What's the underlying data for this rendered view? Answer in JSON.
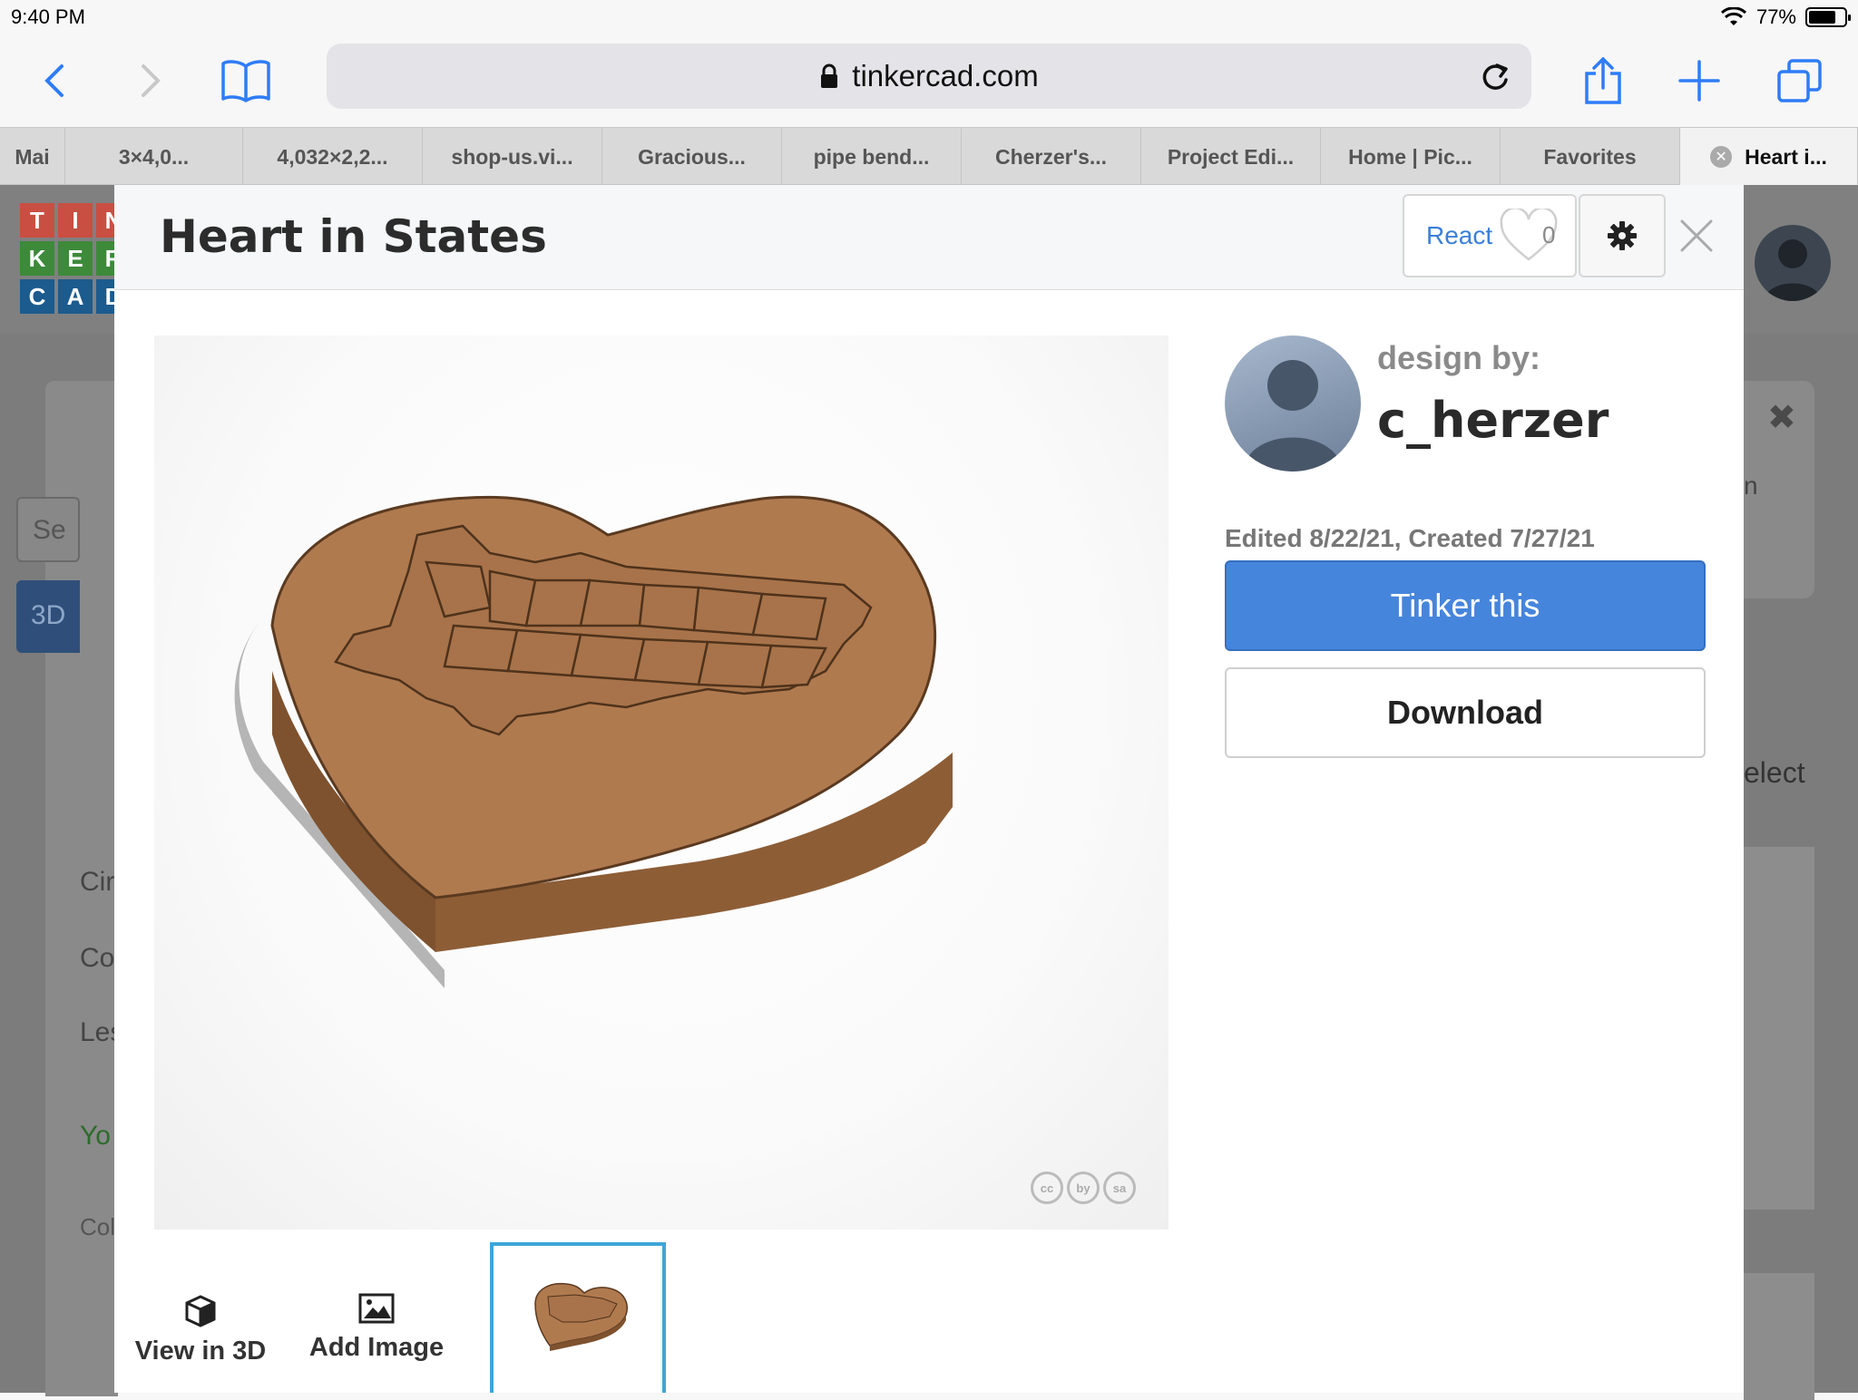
{
  "status_bar": {
    "time": "9:40 PM",
    "battery": "77%",
    "battery_level": 0.77
  },
  "browser": {
    "url": "tinkercad.com",
    "tabs": [
      {
        "label": "Mai",
        "active": false
      },
      {
        "label": "3×4,0...",
        "active": false
      },
      {
        "label": "4,032×2,2...",
        "active": false
      },
      {
        "label": "shop-us.vi...",
        "active": false
      },
      {
        "label": "Gracious...",
        "active": false
      },
      {
        "label": "pipe bend...",
        "active": false
      },
      {
        "label": "Cherzer's...",
        "active": false
      },
      {
        "label": "Project Edi...",
        "active": false
      },
      {
        "label": "Home | Pic...",
        "active": false
      },
      {
        "label": "Favorites",
        "active": false
      },
      {
        "label": "Heart i...",
        "active": true
      }
    ]
  },
  "background_page": {
    "logo_letters": [
      "T",
      "I",
      "N",
      "K",
      "E",
      "R",
      "C",
      "A",
      "D"
    ],
    "search_placeholder": "Se",
    "sidebar_items": [
      "3D",
      "Cir",
      "Co",
      "Les",
      "Yo",
      "Col"
    ],
    "right_text": "elect",
    "right_partial": "n",
    "likes": "0"
  },
  "modal": {
    "title": "Heart in States",
    "react_label": "React",
    "react_count": "0",
    "designer_label": "design by:",
    "designer_name": "c_herzer",
    "dates": "Edited 8/22/21, Created 7/27/21",
    "tinker_label": "Tinker this",
    "download_label": "Download",
    "view3d_label": "View in 3D",
    "add_image_label": "Add Image",
    "license_icons": [
      "cc",
      "by",
      "sa"
    ]
  },
  "colors": {
    "accent_blue": "#4685dc",
    "link_blue": "#2f7cf6",
    "model_copper": "#b07a4f",
    "thumb_border": "#3ea6d8"
  }
}
